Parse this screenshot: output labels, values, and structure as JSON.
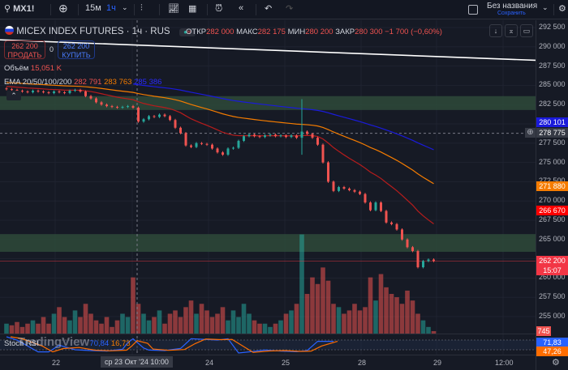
{
  "toolbar": {
    "symbol": "MX1!",
    "interval_15m": "15м",
    "interval_1h": "1ч",
    "layout_name": "Без названия",
    "save_label": "Сохранить",
    "icons": [
      "search-icon",
      "plus-circle-icon",
      "chevron-down-icon",
      "bar-style-icon",
      "indicators-icon",
      "templates-icon",
      "alert-icon",
      "replay-icon",
      "undo-icon",
      "redo-icon",
      "fullscreen-icon",
      "settings-icon"
    ]
  },
  "legend": {
    "title": "MICEX INDEX FUTURES · 1ч · RUS",
    "open_label": "ОТКР",
    "open": "282 000",
    "high_label": "МАКС",
    "high": "282 175",
    "low_label": "МИН",
    "low": "280 200",
    "close_label": "ЗАКР",
    "close": "280 300",
    "change": "−1 700 (−0,60%)",
    "sell_price": "262 200",
    "sell_label": "ПРОДАТЬ",
    "spread": "0",
    "buy_price": "262 200",
    "buy_label": "КУПИТЬ",
    "volume_label": "Объём",
    "volume_value": "15,051 K",
    "ema_label": "EMA 20/50/100/200",
    "ema20": "282 791",
    "ema50": "283 763",
    "ema100": "285 386",
    "stoch_label": "Stoch RSI",
    "stoch_k": "70,84",
    "stoch_d": "16,73",
    "watermark": "TradingView"
  },
  "colors": {
    "up": "#26a69a",
    "down": "#ef5350",
    "ema20": "#b71c1c",
    "ema50": "#f57c00",
    "ema100": "#1a1adb",
    "zone": "#2e4a3a",
    "trendline": "#ffffff"
  },
  "price_axis": {
    "ticks": [
      "292 500",
      "290 000",
      "287 500",
      "285 000",
      "282 500",
      "277 500",
      "275 000",
      "272 500",
      "270 000",
      "267 500",
      "265 000",
      "260 000",
      "257 500",
      "255 000"
    ],
    "labels": {
      "ema100": "280 101",
      "crosshair": "278 775",
      "ema50": "271 880",
      "ema20": "266 670",
      "last": "262 200",
      "countdown": "15:07",
      "volume": "745",
      "stoch_k": "71,83",
      "stoch_d": "47,26"
    }
  },
  "time_axis": {
    "ticks": [
      "22",
      "24",
      "25",
      "28",
      "29",
      "12:00"
    ],
    "crosshair": "ср 23 Окт '24  10:00"
  },
  "chart_data": {
    "type": "candlestick",
    "close": [
      284500,
      284400,
      284300,
      284200,
      284100,
      284300,
      284200,
      284100,
      284000,
      284200,
      284100,
      284000,
      284300,
      284400,
      284200,
      283600,
      283300,
      282800,
      282500,
      282300,
      282200,
      282100,
      282200,
      282300,
      282100,
      280300,
      280600,
      281000,
      280900,
      281200,
      281000,
      280500,
      279500,
      278800,
      277200,
      277000,
      277500,
      277400,
      277300,
      276800,
      276300,
      276000,
      276800,
      276900,
      277800,
      278400,
      278600,
      278400,
      278300,
      278500,
      278600,
      278400,
      278500,
      278300,
      278500,
      278200,
      279000,
      278700,
      278200,
      277300,
      275000,
      272500,
      271300,
      271800,
      271600,
      271400,
      271200,
      270900,
      269800,
      268800,
      269800,
      268700,
      267200,
      267000,
      266300,
      265000,
      264000,
      263500,
      261400,
      262200,
      262400,
      262200
    ],
    "wick_overrides": {
      "56": [
        283200,
        276000
      ]
    },
    "volume": [
      3000,
      2500,
      3500,
      2000,
      3000,
      4000,
      3000,
      5000,
      3000,
      6000,
      8000,
      5000,
      4000,
      7000,
      5000,
      9000,
      6000,
      4000,
      3000,
      5000,
      2000,
      4000,
      6000,
      5000,
      17000,
      9000,
      6000,
      4000,
      5000,
      7000,
      3000,
      6000,
      7000,
      5000,
      8000,
      10000,
      6000,
      9000,
      7000,
      5000,
      6000,
      8000,
      4000,
      7000,
      5000,
      9000,
      6000,
      4000,
      3000,
      3000,
      2000,
      3000,
      4000,
      6000,
      7000,
      9000,
      30000,
      12000,
      17000,
      15000,
      20000,
      16000,
      9000,
      8000,
      6000,
      7000,
      9000,
      7000,
      8000,
      17000,
      10000,
      18000,
      14000,
      12000,
      11000,
      9000,
      13000,
      10000,
      6000,
      4000,
      2000,
      745
    ],
    "stoch_k": [
      [
        0,
        100
      ],
      [
        2,
        80
      ],
      [
        6,
        7
      ],
      [
        8,
        7
      ],
      [
        10,
        48
      ],
      [
        13,
        20
      ],
      [
        16,
        15
      ],
      [
        19,
        12
      ],
      [
        22,
        23
      ],
      [
        23,
        64
      ],
      [
        24,
        88
      ],
      [
        26,
        31
      ],
      [
        27,
        18
      ],
      [
        30,
        15
      ],
      [
        33,
        28
      ],
      [
        35,
        88
      ],
      [
        37,
        85
      ],
      [
        40,
        80
      ],
      [
        42,
        88
      ],
      [
        44,
        0
      ],
      [
        46,
        7
      ],
      [
        49,
        18
      ],
      [
        52,
        12
      ],
      [
        55,
        8
      ],
      [
        57,
        15
      ],
      [
        59,
        72
      ],
      [
        62,
        72
      ]
    ],
    "ema_seeds": {
      "ema20": 284900,
      "ema50": 285400,
      "ema100": 286300
    },
    "trendline": [
      290900,
      288250
    ],
    "zones": [
      [
        283600,
        281800
      ],
      [
        265700,
        263400
      ]
    ]
  }
}
